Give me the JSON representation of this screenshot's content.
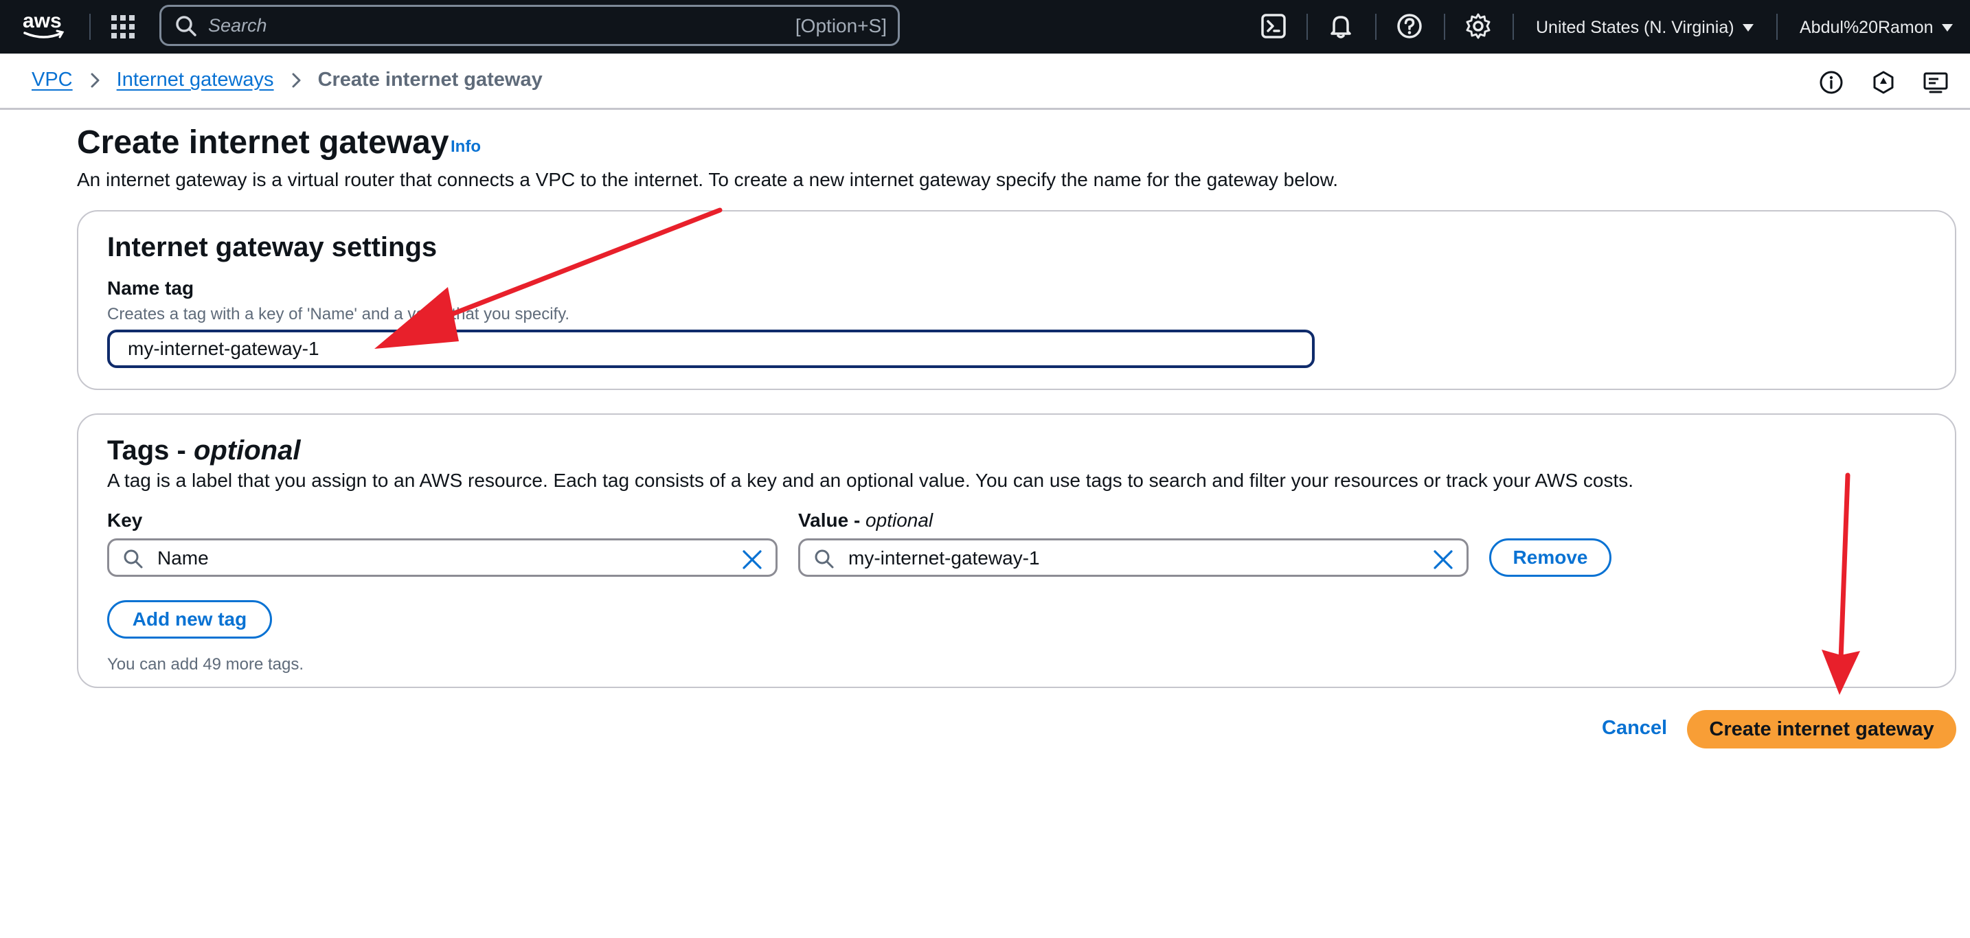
{
  "topnav": {
    "logo_text": "aws",
    "search_placeholder": "Search",
    "search_shortcut": "[Option+S]",
    "icons": [
      "cloudshell-icon",
      "bell-icon",
      "help-icon",
      "gear-icon"
    ],
    "region": "United States (N. Virginia)",
    "user": "Abdul%20Ramon"
  },
  "breadcrumb": {
    "items": [
      "VPC",
      "Internet gateways"
    ],
    "current": "Create internet gateway"
  },
  "utility_icons": [
    "info-circle-icon",
    "feedback-icon",
    "screen-icon"
  ],
  "page": {
    "title": "Create internet gateway",
    "info_link": "Info",
    "description": "An internet gateway is a virtual router that connects a VPC to the internet. To create a new internet gateway specify the name for the gateway below."
  },
  "settings": {
    "title": "Internet gateway settings",
    "name_tag_label": "Name tag",
    "name_tag_description": "Creates a tag with a key of 'Name' and a value that you specify.",
    "name_tag_value": "my-internet-gateway-1"
  },
  "tags": {
    "title": "Tags - ",
    "title_suffix": "optional",
    "description": "A tag is a label that you assign to an AWS resource. Each tag consists of a key and an optional value. You can use tags to search and filter your resources or track your AWS costs.",
    "key_label": "Key",
    "value_label": "Value - ",
    "value_label_suffix": "optional",
    "rows": [
      {
        "key": "Name",
        "value": "my-internet-gateway-1"
      }
    ],
    "remove_label": "Remove",
    "add_label": "Add new tag",
    "remaining_hint": "You can add 49 more tags."
  },
  "actions": {
    "cancel_label": "Cancel",
    "create_label": "Create internet gateway"
  },
  "colors": {
    "nav_bg": "#0f141a",
    "link": "#0972d3",
    "primary": "#f89e36",
    "annotation_arrow": "#e8202b"
  }
}
